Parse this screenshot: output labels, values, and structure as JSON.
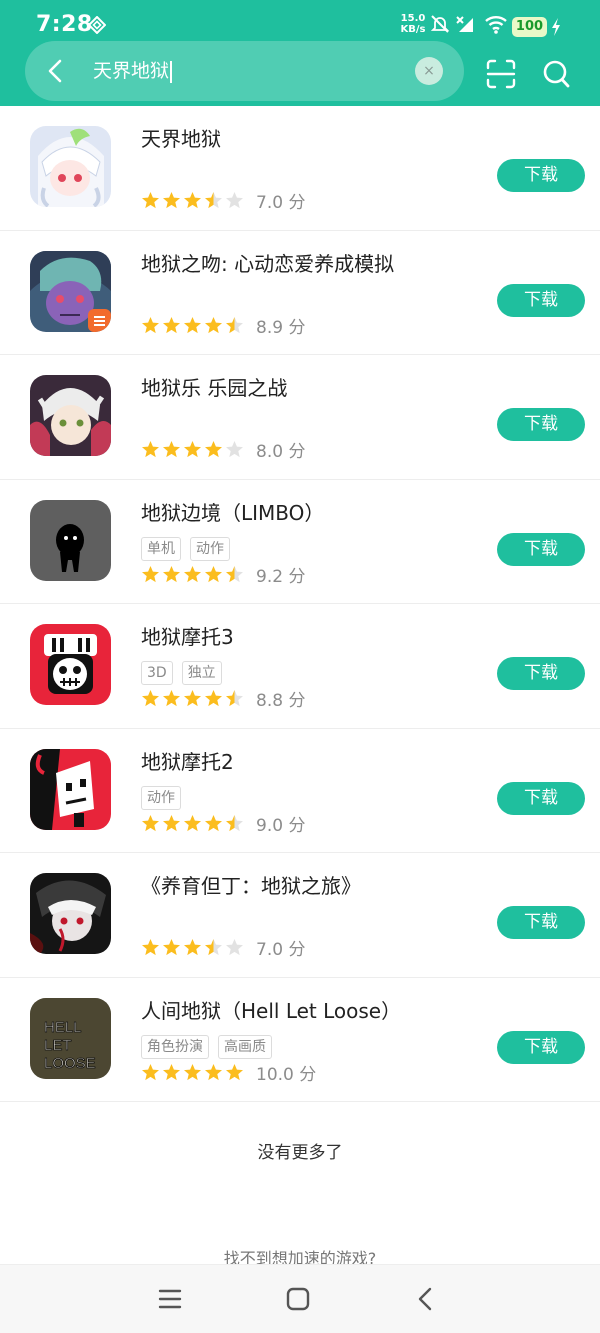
{
  "status_bar": {
    "time": "7:28",
    "net_speed_value": "15.0",
    "net_speed_unit": "KB/s",
    "battery": "100"
  },
  "search": {
    "query": "天界地狱",
    "clear_label": "×"
  },
  "download_label": "下载",
  "apps": [
    {
      "name": "天界地狱",
      "tags": [],
      "rating": 3.5,
      "score": "7.0 分",
      "icon": "anime-girl-icon"
    },
    {
      "name": "地狱之吻: 心动恋爱养成模拟",
      "tags": [],
      "rating": 4.5,
      "score": "8.9 分",
      "icon": "anime-demon-icon"
    },
    {
      "name": "地狱乐 乐园之战",
      "tags": [],
      "rating": 4,
      "score": "8.0 分",
      "icon": "anime-boy-icon"
    },
    {
      "name": "地狱边境（LIMBO）",
      "tags": [
        "单机",
        "动作"
      ],
      "rating": 4.5,
      "score": "9.2 分",
      "icon": "limbo-silhouette-icon"
    },
    {
      "name": "地狱摩托3",
      "tags": [
        "3D",
        "独立"
      ],
      "rating": 4.5,
      "score": "8.8 分",
      "icon": "skull-helmet-icon"
    },
    {
      "name": "地狱摩托2",
      "tags": [
        "动作"
      ],
      "rating": 4.5,
      "score": "9.0 分",
      "icon": "devil-skull-icon"
    },
    {
      "name": "《养育但丁：地狱之旅》",
      "tags": [],
      "rating": 3.5,
      "score": "7.0 分",
      "icon": "dark-anime-icon"
    },
    {
      "name": "人间地狱（Hell Let Loose）",
      "tags": [
        "角色扮演",
        "高画质"
      ],
      "rating": 5,
      "score": "10.0 分",
      "icon": "hell-let-loose-icon",
      "icon_text": [
        "HELL",
        "LET",
        "LOOSE"
      ]
    }
  ],
  "footer": {
    "no_more": "没有更多了",
    "not_found": "找不到想加速的游戏?"
  },
  "colors": {
    "accent": "#1fbf9e",
    "star": "#fbbd1e",
    "star_empty": "#e2e2e2"
  }
}
